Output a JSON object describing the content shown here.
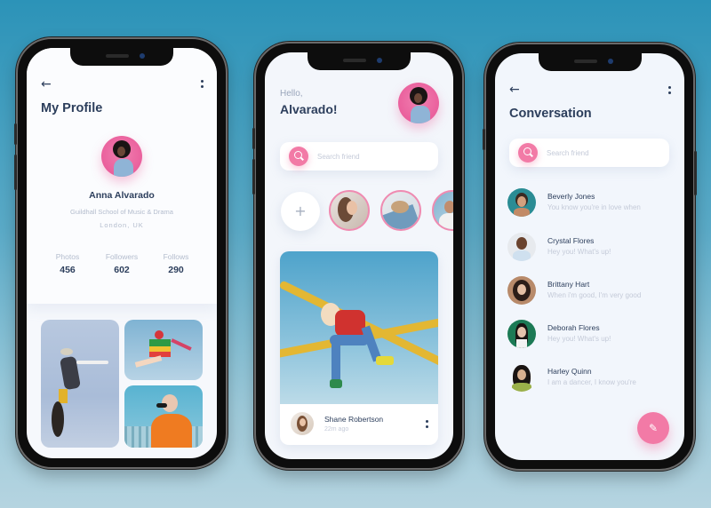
{
  "profile_screen": {
    "back_icon": "arrow-left-icon",
    "menu_icon": "more-vertical-icon",
    "title": "My Profile",
    "name": "Anna Alvarado",
    "school": "Guildhall School of Music & Drama",
    "location": "London, UK",
    "stats": [
      {
        "label": "Photos",
        "value": "456"
      },
      {
        "label": "Followers",
        "value": "602"
      },
      {
        "label": "Follows",
        "value": "290"
      }
    ]
  },
  "home_screen": {
    "greeting": "Hello,",
    "username": "Alvarado!",
    "search_placeholder": "Search friend",
    "add_story_label": "+",
    "post": {
      "author": "Shane Robertson",
      "time": "22m ago",
      "menu_icon": "more-vertical-icon"
    }
  },
  "conversation_screen": {
    "back_icon": "arrow-left-icon",
    "menu_icon": "more-vertical-icon",
    "title": "Conversation",
    "search_placeholder": "Search friend",
    "conversations": [
      {
        "name": "Beverly Jones",
        "message": "You know you're in love when"
      },
      {
        "name": "Crystal Flores",
        "message": "Hey you! What's up!"
      },
      {
        "name": "Brittany Hart",
        "message": "When i'm good, I'm very good"
      },
      {
        "name": "Deborah Flores",
        "message": "Hey you! What's up!"
      },
      {
        "name": "Harley Quinn",
        "message": "I am a dancer, I know you're"
      }
    ],
    "compose_icon": "edit-icon"
  },
  "colors": {
    "accent": "#f27aa6",
    "title": "#2c3e5c",
    "muted": "#b3bccd",
    "background_top": "#2c93b8",
    "background_bottom": "#b5d4e0"
  }
}
